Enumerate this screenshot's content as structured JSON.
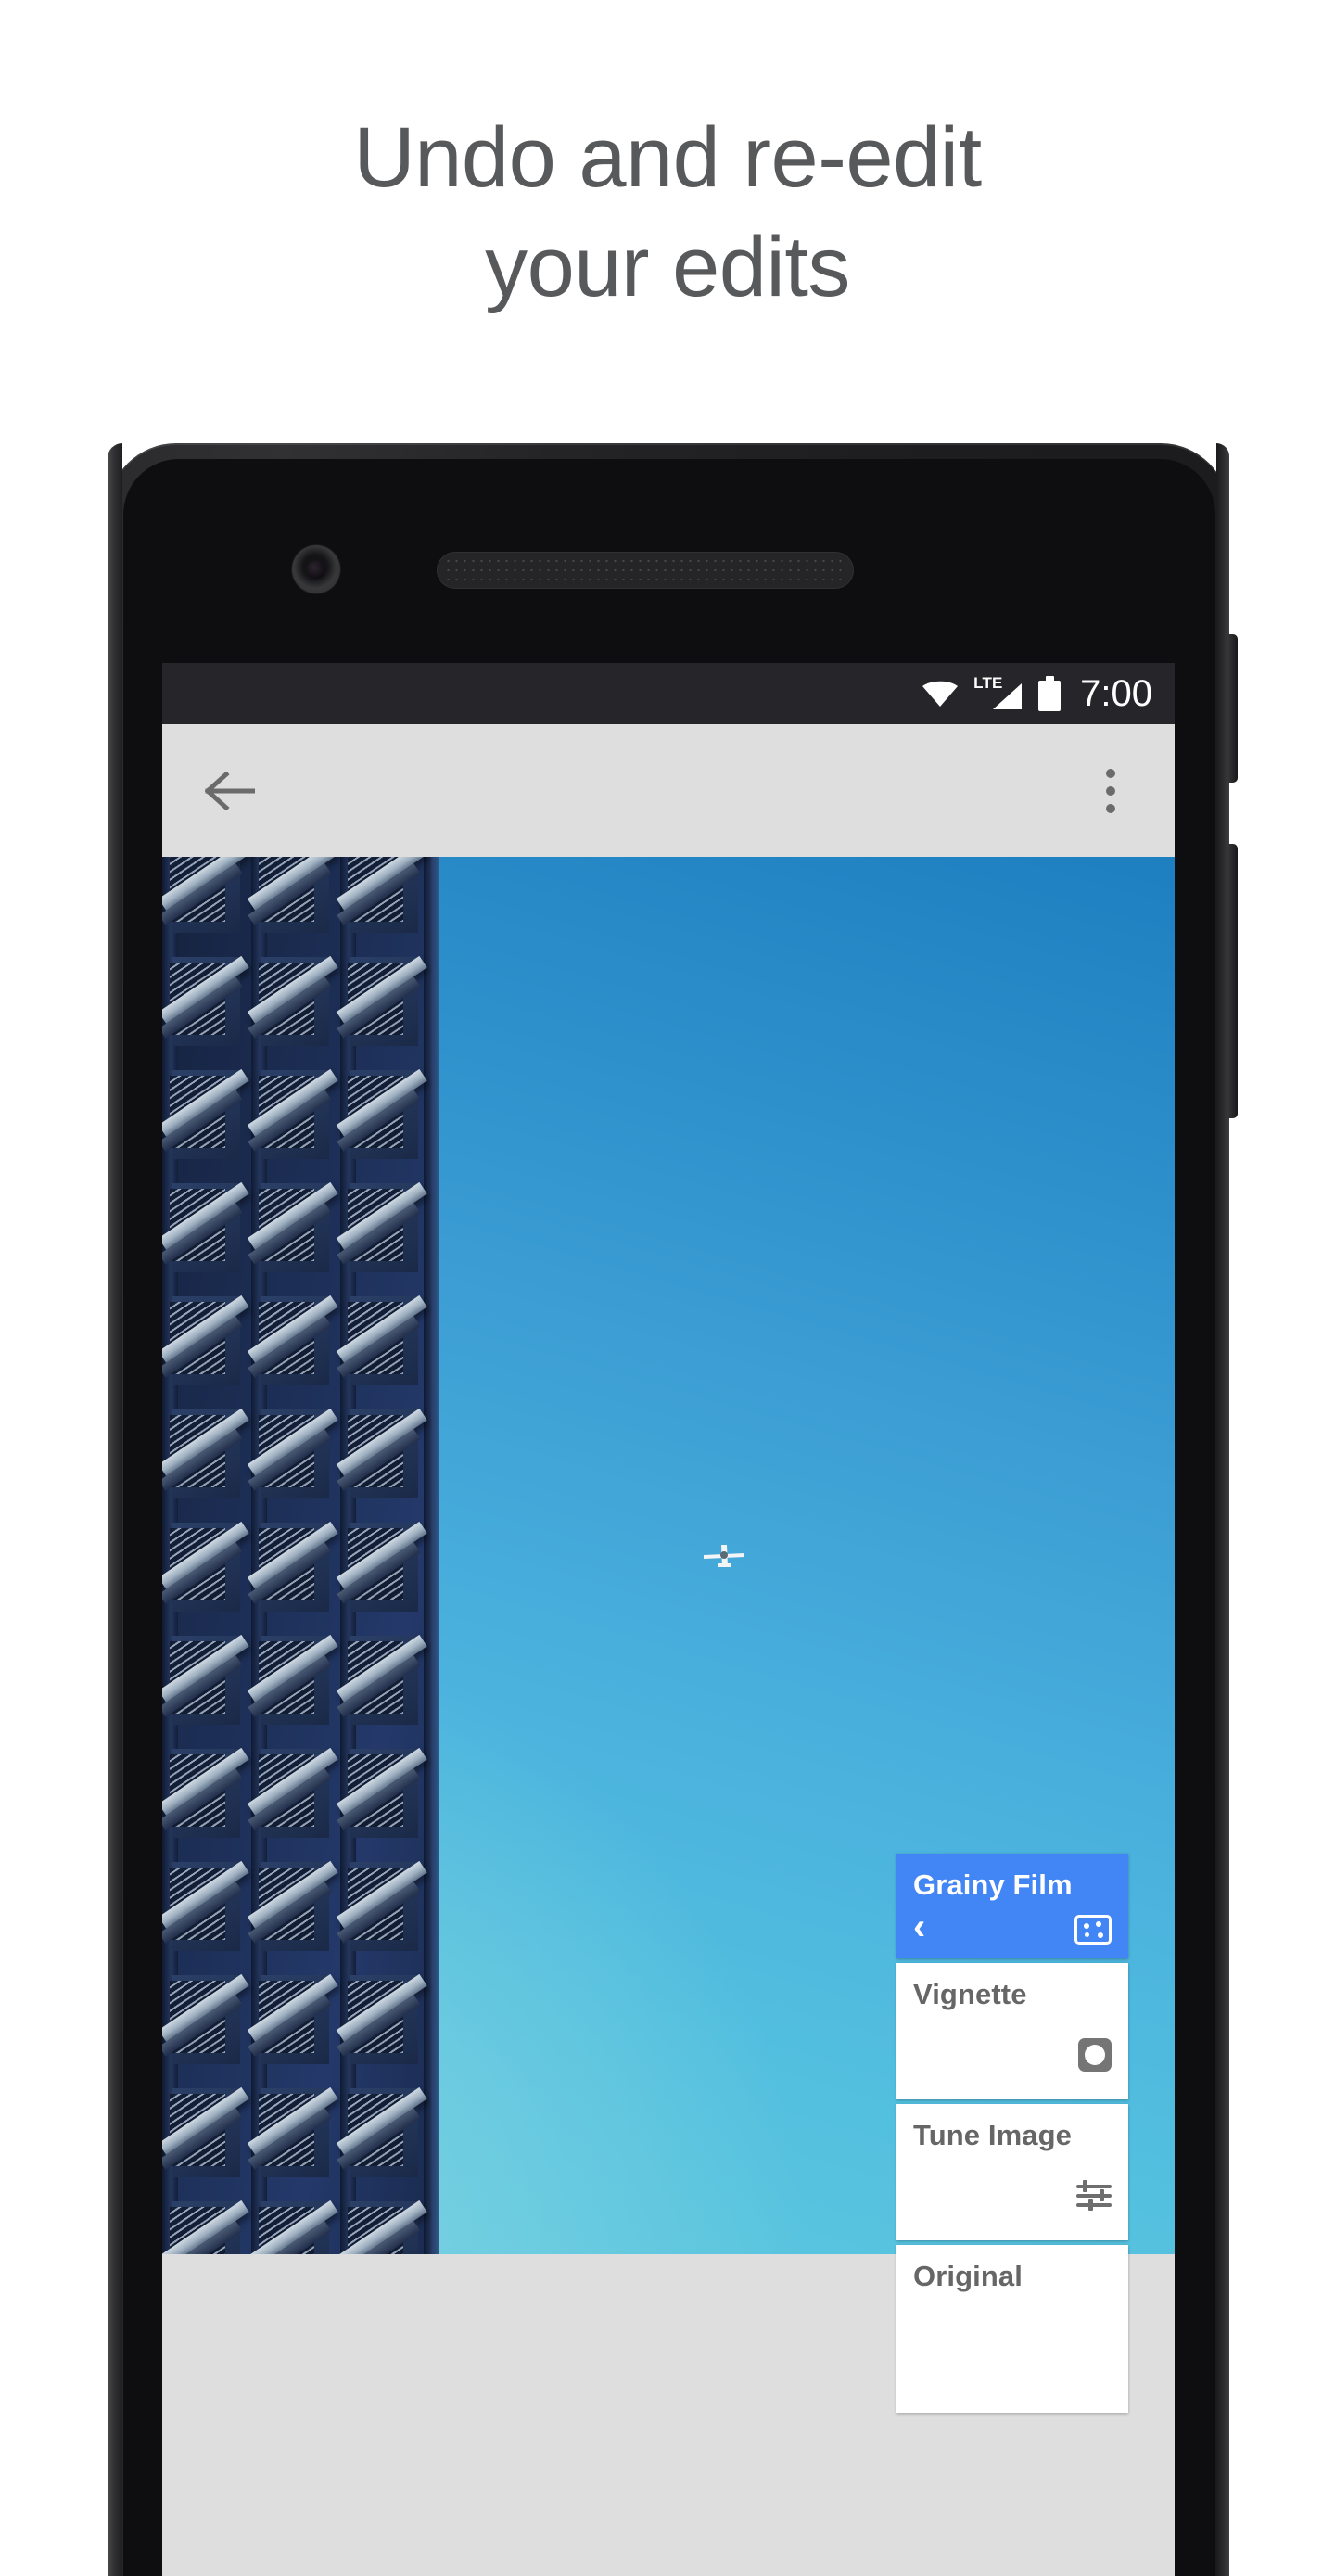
{
  "headline": {
    "line1": "Undo and re-edit",
    "line2": "your edits"
  },
  "phone": {
    "hardware": {
      "front_camera": "front-camera",
      "earpiece_speaker": "earpiece-speaker",
      "power_button": "power-button",
      "volume_button": "volume-button"
    },
    "status_bar": {
      "wifi_icon": "wifi-icon",
      "network_label": "LTE",
      "signal_icon": "signal-bars-icon",
      "battery_icon": "battery-full-icon",
      "time": "7:00",
      "background_color": "#26262a"
    },
    "toolbar": {
      "back_icon": "back-arrow-icon",
      "overflow_icon": "overflow-menu-icon",
      "background_color": "#dedede"
    },
    "photo": {
      "subject": "blue office building facade with angled balcony awnings and a small airplane in the sky",
      "airplane_icon": "airplane-icon",
      "sky_color_top": "#1d7fc0",
      "sky_color_bottom": "#5fc9df",
      "building_color": "#1b2c52"
    },
    "edit_stack": {
      "accent_color": "#4285f4",
      "cards": [
        {
          "label": "Grainy Film",
          "icon": "grain-icon",
          "back_icon": "chevron-left-icon",
          "active": true
        },
        {
          "label": "Vignette",
          "icon": "vignette-icon",
          "active": false
        },
        {
          "label": "Tune Image",
          "icon": "tune-sliders-icon",
          "active": false
        },
        {
          "label": "Original",
          "icon": "",
          "active": false
        }
      ]
    }
  }
}
